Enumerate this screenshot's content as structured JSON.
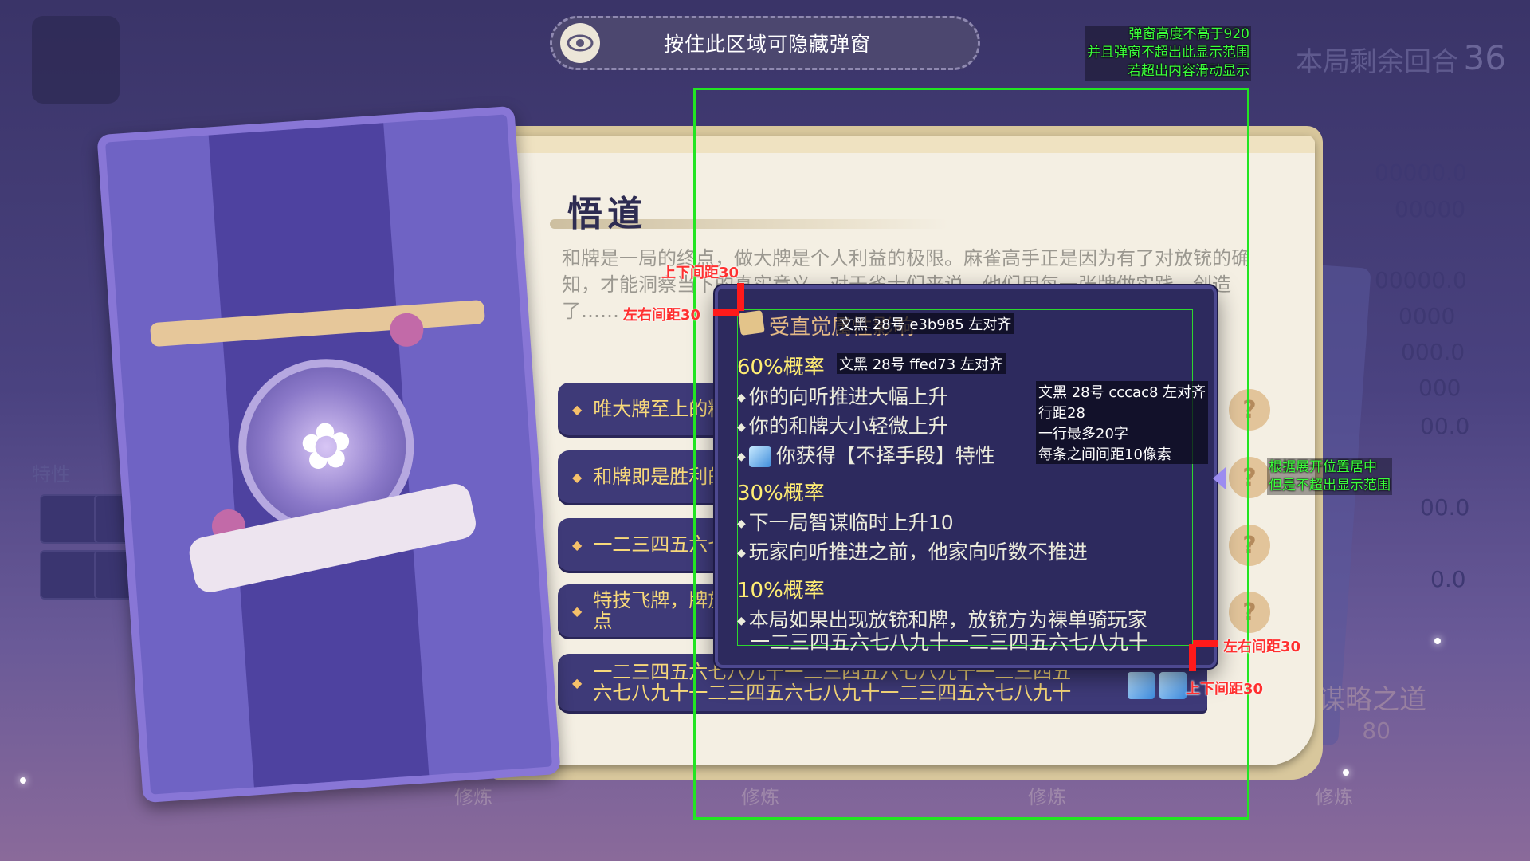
{
  "hide_hint": {
    "text": "按住此区域可隐藏弹窗"
  },
  "background": {
    "remaining_label": "本局剩余回合",
    "remaining_value": "36",
    "stats": [
      "00000.0",
      "00000",
      "00000.0",
      "0000",
      "000.0",
      "000",
      "00.0",
      "00.0",
      "0.0"
    ],
    "trait_label": "特性",
    "bottom_tabs": [
      "修炼",
      "修炼",
      "修炼",
      "修炼"
    ],
    "right_word": "谋略之道",
    "right_number": "80"
  },
  "panel": {
    "title": "悟道",
    "description": "和牌是一局的终点，做大牌是个人利益的极限。麻雀高手正是因为有了对放铳的确知，才能洞察当下的真实意义，对于雀士们来说，他们用每一张牌做实践，创造了……",
    "items": [
      {
        "label": "唯大牌至上的精神"
      },
      {
        "label": "和牌即是胜利的精神"
      },
      {
        "label": "一二三四五六七八九十"
      },
      {
        "label": "特技飞牌，牌旅转化，技艺落定，成为全才的焦点"
      },
      {
        "label": "一二三四五六七八九十一二三四五六七八九十一二三四五六七八九十一二三四五六七八九十一二三四五六七八九十"
      }
    ]
  },
  "popup": {
    "header": "受直觉属性影响",
    "sections": [
      {
        "percent": "60%概率",
        "lines": [
          "你的向听推进大幅上升",
          "你的和牌大小轻微上升",
          "你获得【不择手段】特性"
        ]
      },
      {
        "percent": "30%概率",
        "lines": [
          "下一局智谋临时上升10",
          "玩家向听推进之前，他家向听数不推进"
        ]
      },
      {
        "percent": "10%概率",
        "lines": [
          "本局如果出现放铳和牌，放铳方为裸单骑玩家",
          "一二三四五六七八九十一二三四五六七八九十"
        ]
      }
    ]
  },
  "annotations": {
    "header_spec": "文黑 28号 e3b985 左对齐",
    "percent_spec": "文黑 28号 ffed73 左对齐",
    "body_spec": [
      "文黑 28号 cccac8 左对齐",
      "行距28",
      "一行最多20字",
      "每条之间间距10像素"
    ],
    "frame_note": [
      "弹窗高度不高于920",
      "并且弹窗不超出此显示范围",
      "若超出内容滑动显示"
    ],
    "center_note": [
      "根据展开位置居中",
      "但是不超出显示范围"
    ],
    "spacing_vertical": "上下间距30",
    "spacing_horizontal": "左右间距30"
  },
  "colors": {
    "header": "#e3b985",
    "percent": "#ffed73",
    "body": "#cccac8",
    "frame": "#22e522",
    "marker": "#ff1a1a"
  }
}
